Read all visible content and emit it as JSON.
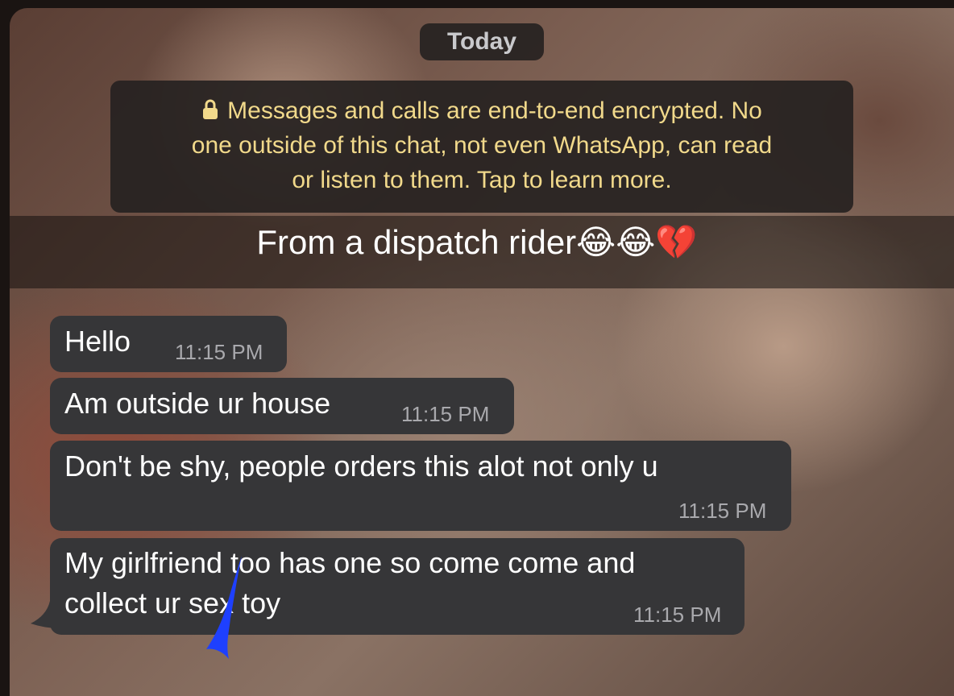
{
  "chat": {
    "date_label": "Today",
    "encryption_notice": {
      "line1": "Messages and calls are end-to-end encrypted. No",
      "line2": "one outside of this chat, not even WhatsApp, can read",
      "line3": "or listen to them. Tap to learn more."
    },
    "caption": "From a dispatch rider😂😂💔",
    "messages": [
      {
        "text": "Hello",
        "time": "11:15 PM"
      },
      {
        "text": "Am outside ur house",
        "time": "11:15 PM"
      },
      {
        "text": "Don't be shy, people orders this alot not only u",
        "time": "11:15 PM"
      },
      {
        "line1": "My girlfriend too has one so come come and",
        "line2": "collect ur sex toy",
        "time": "11:15 PM"
      }
    ]
  },
  "colors": {
    "bubble": "#363638",
    "notice_text": "#f1d98b",
    "annotation_mark": "#1e40ff"
  },
  "icons": [
    "lock-icon",
    "pen-mark"
  ]
}
